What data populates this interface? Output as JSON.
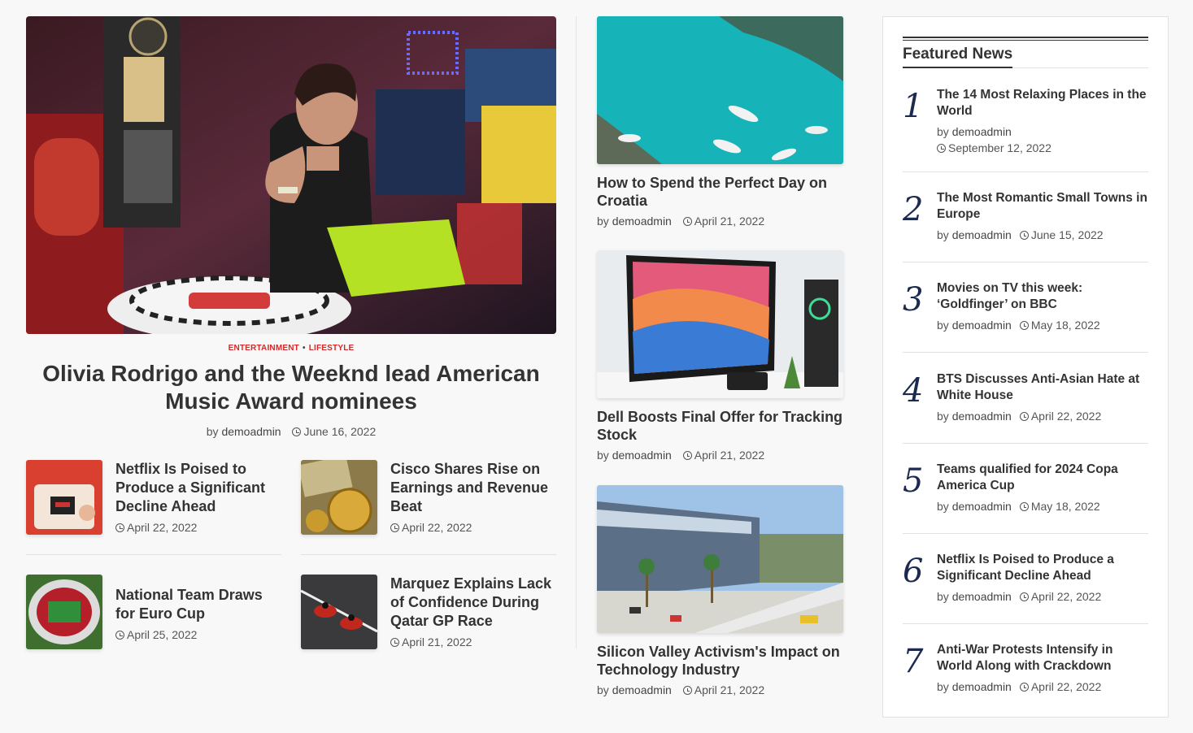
{
  "hero": {
    "category1": "ENTERTAINMENT",
    "category2": "LIFESTYLE",
    "title": "Olivia Rodrigo and the Weeknd lead American Music Award nominees",
    "by": "by",
    "author": "demoadmin",
    "date": "June 16, 2022"
  },
  "small_posts": [
    {
      "title": "Netflix Is Poised to Produce a Significant Decline Ahead",
      "date": "April 22, 2022"
    },
    {
      "title": "Cisco Shares Rise on Earnings and Revenue Beat",
      "date": "April 22, 2022"
    },
    {
      "title": "National Team Draws for Euro Cup",
      "date": "April 25, 2022"
    },
    {
      "title": "Marquez Explains Lack of Confidence During Qatar GP Race",
      "date": "April 21, 2022"
    }
  ],
  "middle_posts": [
    {
      "title": "How to Spend the Perfect Day on Croatia",
      "by": "by",
      "author": "demoadmin",
      "date": "April 21, 2022"
    },
    {
      "title": "Dell Boosts Final Offer for Tracking Stock",
      "by": "by",
      "author": "demoadmin",
      "date": "April 21, 2022"
    },
    {
      "title": "Silicon Valley Activism's Impact on Technology Industry",
      "by": "by",
      "author": "demoadmin",
      "date": "April 21, 2022"
    }
  ],
  "featured": {
    "heading": "Featured News",
    "items": [
      {
        "num": "1",
        "title": "The 14 Most Relaxing Places in the World",
        "by": "by",
        "author": "demoadmin",
        "date": "September 12, 2022"
      },
      {
        "num": "2",
        "title": "The Most Romantic Small Towns in Europe",
        "by": "by",
        "author": "demoadmin",
        "date": "June 15, 2022"
      },
      {
        "num": "3",
        "title": "Movies on TV this week: ‘Goldfinger’ on BBC",
        "by": "by",
        "author": "demoadmin",
        "date": "May 18, 2022"
      },
      {
        "num": "4",
        "title": "BTS Discusses Anti-Asian Hate at White House",
        "by": "by",
        "author": "demoadmin",
        "date": "April 22, 2022"
      },
      {
        "num": "5",
        "title": "Teams qualified for 2024 Copa America Cup",
        "by": "by",
        "author": "demoadmin",
        "date": "May 18, 2022"
      },
      {
        "num": "6",
        "title": "Netflix Is Poised to Produce a Significant Decline Ahead",
        "by": "by",
        "author": "demoadmin",
        "date": "April 22, 2022"
      },
      {
        "num": "7",
        "title": "Anti-War Protests Intensify in World Along with Crackdown",
        "by": "by",
        "author": "demoadmin",
        "date": "April 22, 2022"
      }
    ]
  },
  "colors": {
    "category": "#d62828",
    "heading": "#333333",
    "number": "#1d2a50",
    "divider": "#e2e2e2"
  }
}
